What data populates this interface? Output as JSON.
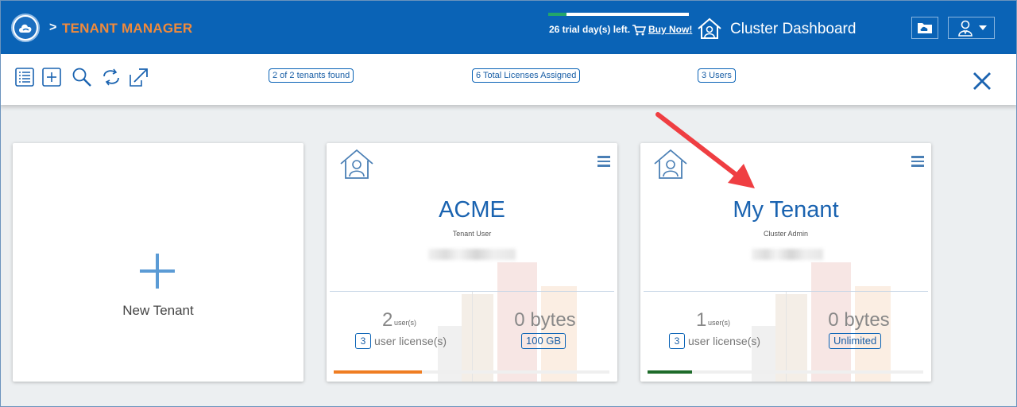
{
  "header": {
    "breadcrumb_sep": ">",
    "app_title": "TENANT MANAGER",
    "trial_progress": 0.13,
    "trial_text": "26 trial day(s) left.",
    "buy_link": "Buy Now!",
    "cluster_dashboard": "Cluster Dashboard",
    "colors": {
      "bar": "#0a63b6",
      "title": "#f08a3c",
      "trial_fill": "#23a66a"
    }
  },
  "toolbar": {
    "tools": [
      "list-view-icon",
      "add-tenant-icon",
      "search-icon",
      "refresh-icon",
      "export-icon"
    ],
    "tenants_found": "2 of 2 tenants found",
    "licenses": "6 Total Licenses Assigned",
    "users": "3 Users"
  },
  "new_tenant": {
    "label": "New Tenant"
  },
  "tenants": [
    {
      "name": "ACME",
      "role": "Tenant User",
      "users_count": "2",
      "users_unit": "user(s)",
      "license_count": "3",
      "license_label": "user license(s)",
      "storage_used": "0 bytes",
      "quota": "100 GB",
      "usage_bar_fraction": 0.32,
      "usage_color": "#ef7d22"
    },
    {
      "name": "My Tenant",
      "role": "Cluster Admin",
      "users_count": "1",
      "users_unit": "user(s)",
      "license_count": "3",
      "license_label": "user license(s)",
      "storage_used": "0 bytes",
      "quota": "Unlimited",
      "usage_bar_fraction": 0.16,
      "usage_color": "#1e6b2a"
    }
  ],
  "annotation": {
    "arrow_color": "#ef3e42"
  }
}
